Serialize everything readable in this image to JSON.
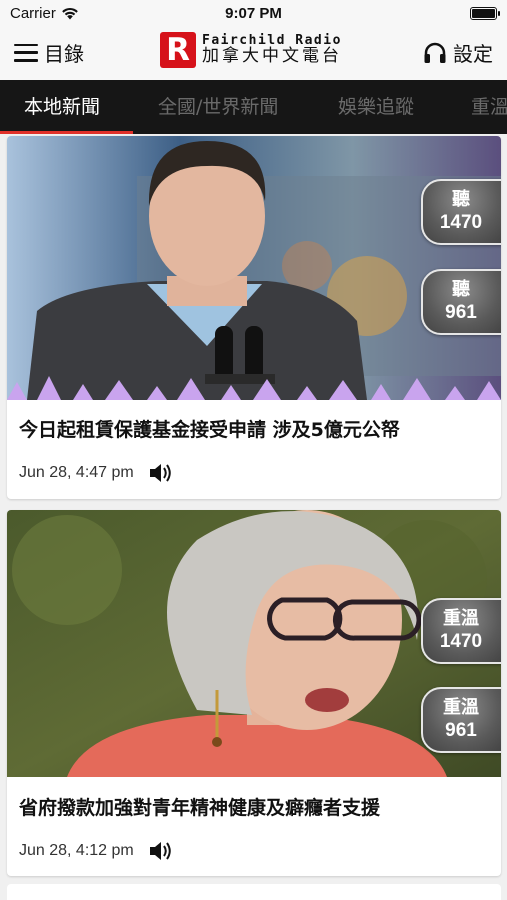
{
  "status_bar": {
    "carrier": "Carrier",
    "time": "9:07 PM"
  },
  "header": {
    "menu_label": "目錄",
    "logo_en": "Fairchild Radio",
    "logo_zh": "加拿大中文電台",
    "settings_label": "設定"
  },
  "tabs": [
    {
      "label": "本地新聞",
      "active": true
    },
    {
      "label": "全國/世界新聞",
      "active": false
    },
    {
      "label": "娛樂追蹤",
      "active": false
    },
    {
      "label": "重溫",
      "active": false
    }
  ],
  "articles": [
    {
      "title": "今日起租賃保護基金接受申請  涉及5億元公帑",
      "timestamp": "Jun 28, 4:47 pm",
      "image_subject": "man-speaking-at-podium",
      "buttons": [
        {
          "label": "聽",
          "frequency": "1470"
        },
        {
          "label": "聽",
          "frequency": "961"
        }
      ]
    },
    {
      "title": "省府撥款加強對青年精神健康及癖癮者支援",
      "timestamp": "Jun 28, 4:12 pm",
      "image_subject": "woman-with-glasses-speaking",
      "buttons": [
        {
          "label": "重溫",
          "frequency": "1470"
        },
        {
          "label": "重溫",
          "frequency": "961"
        }
      ]
    }
  ],
  "colors": {
    "tab_bar_bg": "#161616",
    "tab_active": "#ffffff",
    "tab_inactive": "#6a6a6a",
    "tab_indicator": "#e0312a",
    "brand_red": "#d6121a"
  }
}
